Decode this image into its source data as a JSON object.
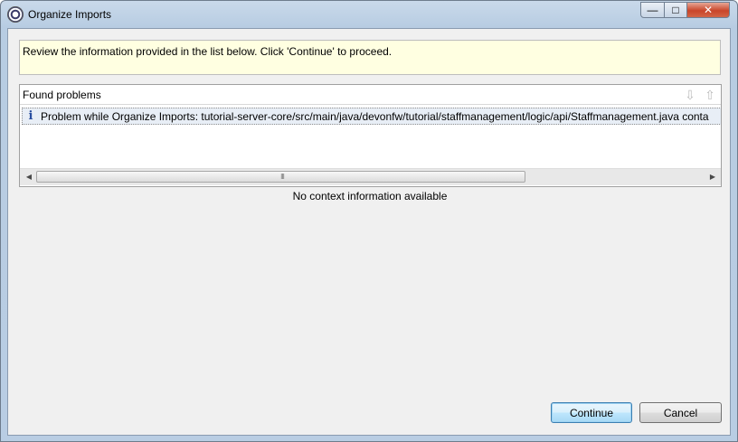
{
  "window": {
    "title": "Organize Imports",
    "minimize_glyph": "—",
    "maximize_glyph": "□",
    "close_glyph": "✕",
    "icon": "eclipse-icon"
  },
  "banner": {
    "message": "Review the information provided in the list below. Click 'Continue' to proceed."
  },
  "problems": {
    "header": "Found problems",
    "down_icon": "⇩",
    "up_icon": "⇧",
    "items": [
      {
        "icon": "i",
        "text": "Problem while Organize Imports: tutorial-server-core/src/main/java/devonfw/tutorial/staffmanagement/logic/api/Staffmanagement.java conta"
      }
    ],
    "scroll_left": "◀",
    "scroll_right": "▶",
    "scroll_grip": "III"
  },
  "context": {
    "message": "No context information available"
  },
  "buttons": {
    "continue": "Continue",
    "cancel": "Cancel"
  },
  "colors": {
    "banner_bg": "#ffffe1",
    "selected_row": "#e8eef6",
    "info_icon": "#2a4fa0"
  }
}
